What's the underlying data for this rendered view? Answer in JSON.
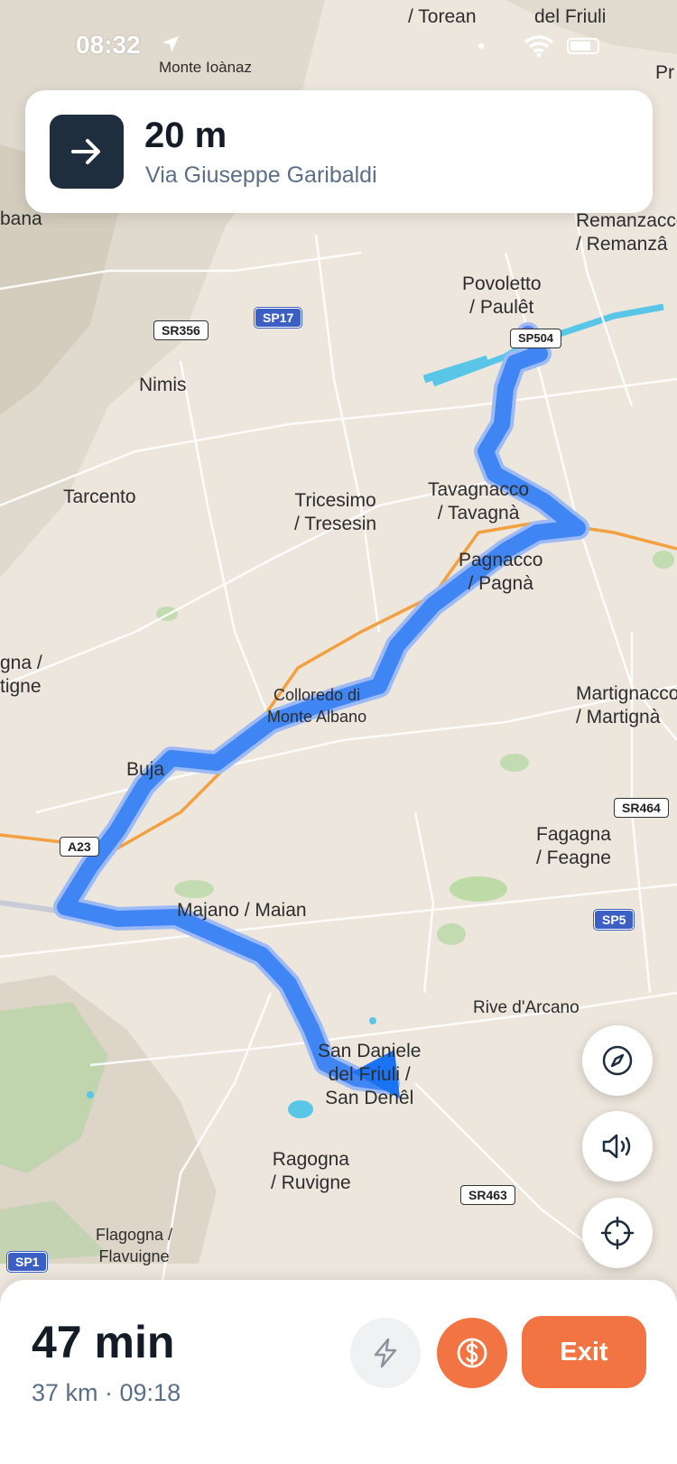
{
  "status_bar": {
    "time": "08:32"
  },
  "navigation": {
    "distance": "20 m",
    "street": "Via Giuseppe Garibaldi",
    "turn_icon": "arrow-right-icon"
  },
  "map": {
    "places": [
      {
        "id": "torean",
        "l1": "/ Torean",
        "l2": ""
      },
      {
        "id": "del-friuli",
        "l1": "del Friuli",
        "l2": ""
      },
      {
        "id": "pr",
        "l1": "Pr",
        "l2": ""
      },
      {
        "id": "monte-ioanaz",
        "l1": "Monte Ioànaz",
        "l2": ""
      },
      {
        "id": "bana",
        "l1": "bana",
        "l2": ""
      },
      {
        "id": "remanzacco",
        "l1": "Remanzacco",
        "l2": "/ Remanzâ"
      },
      {
        "id": "povoletto",
        "l1": "Povoletto",
        "l2": "/ Paulêt"
      },
      {
        "id": "nimis",
        "l1": "Nimis",
        "l2": ""
      },
      {
        "id": "tarcento",
        "l1": "Tarcento",
        "l2": ""
      },
      {
        "id": "tricesimo",
        "l1": "Tricesimo",
        "l2": "/ Tresesin"
      },
      {
        "id": "tavagnacco",
        "l1": "Tavagnacco",
        "l2": "/ Tavagnà"
      },
      {
        "id": "pagnacco",
        "l1": "Pagnacco",
        "l2": "/ Pagnà"
      },
      {
        "id": "gna",
        "l1": "gna /",
        "l2": "tigne"
      },
      {
        "id": "colloredo",
        "l1": "Colloredo di",
        "l2": "Monte Albano"
      },
      {
        "id": "martignacco",
        "l1": "Martignacco",
        "l2": "/ Martignà"
      },
      {
        "id": "buja",
        "l1": "Buja",
        "l2": ""
      },
      {
        "id": "fagagna",
        "l1": "Fagagna",
        "l2": "/ Feagne"
      },
      {
        "id": "majano",
        "l1": "Majano / Maian",
        "l2": ""
      },
      {
        "id": "rive-darcano",
        "l1": "Rive d'Arcano",
        "l2": ""
      },
      {
        "id": "san-daniele",
        "l1": "San Daniele",
        "l2": "del Friuli /",
        "l3": "San Denêl"
      },
      {
        "id": "ragogna",
        "l1": "Ragogna",
        "l2": "/ Ruvigne"
      },
      {
        "id": "flagogna",
        "l1": "Flagogna /",
        "l2": "Flavuigne"
      }
    ],
    "roads": {
      "sr356": "SR356",
      "sp17": "SP17",
      "s504": "SP504",
      "a23": "A23",
      "sr464": "SR464",
      "sp5": "SP5",
      "sr463": "SR463",
      "sp1": "SP1"
    }
  },
  "controls": {
    "compass_icon": "compass-icon",
    "sound_icon": "speaker-icon",
    "recenter_icon": "crosshair-icon"
  },
  "trip": {
    "duration": "47 min",
    "summary": "37 km · 09:18",
    "exit_label": "Exit",
    "bolt_icon": "bolt-icon",
    "dollar_icon": "dollar-icon"
  },
  "colors": {
    "route": "#3f86f4",
    "accent": "#f37443",
    "card_dark": "#1f2e3f"
  }
}
